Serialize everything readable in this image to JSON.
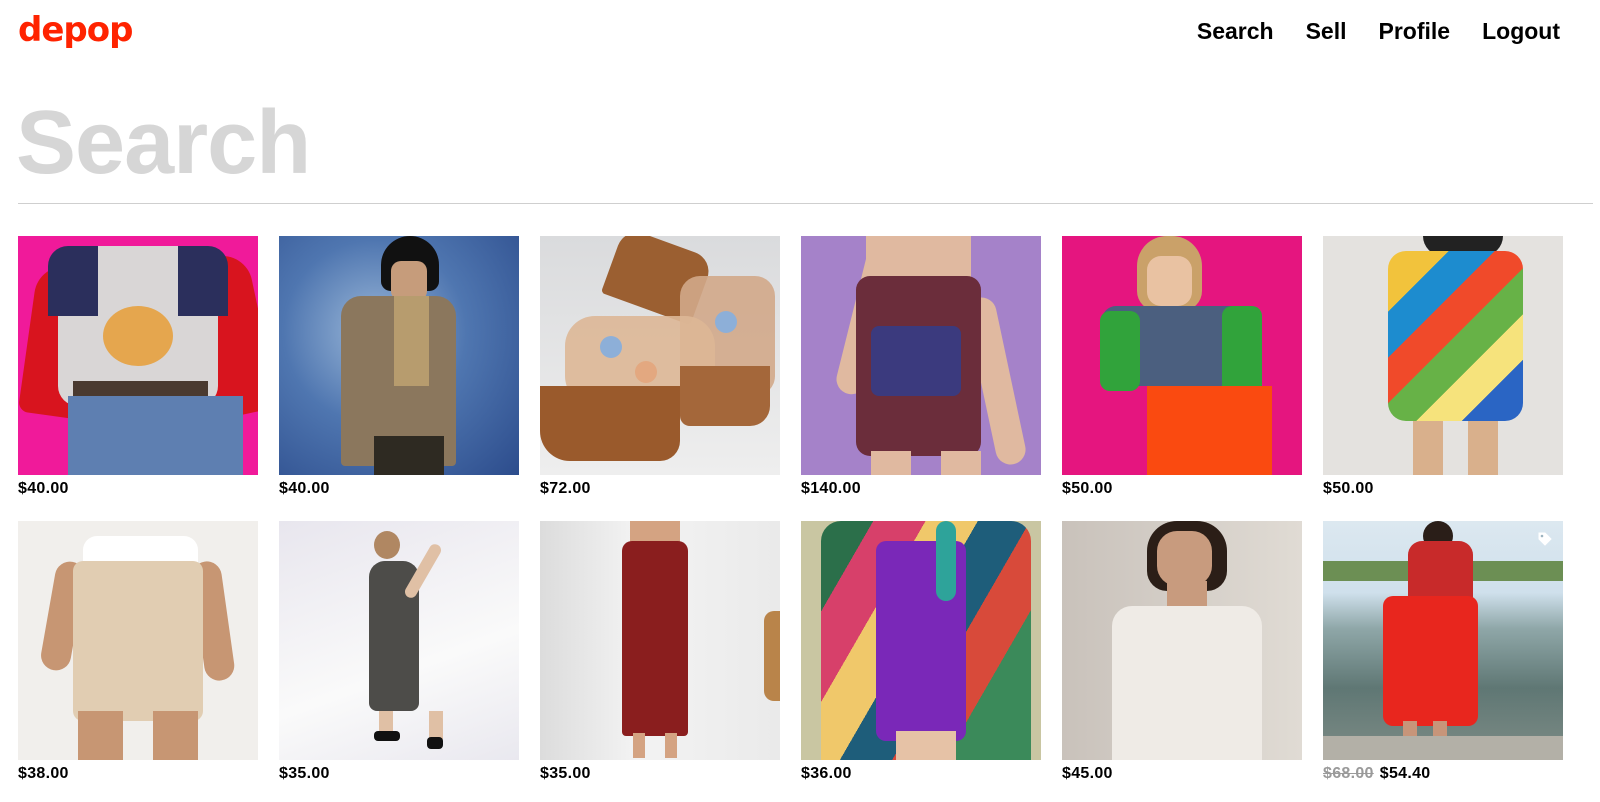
{
  "brand": {
    "logo_text": "depop",
    "color": "#ff2300"
  },
  "nav": {
    "items": [
      {
        "label": "Search"
      },
      {
        "label": "Sell"
      },
      {
        "label": "Profile"
      },
      {
        "label": "Logout"
      }
    ]
  },
  "page": {
    "title": "Search"
  },
  "products": [
    {
      "price": "$40.00",
      "original_price": ""
    },
    {
      "price": "$40.00",
      "original_price": ""
    },
    {
      "price": "$72.00",
      "original_price": ""
    },
    {
      "price": "$140.00",
      "original_price": ""
    },
    {
      "price": "$50.00",
      "original_price": ""
    },
    {
      "price": "$50.00",
      "original_price": ""
    },
    {
      "price": "$38.00",
      "original_price": ""
    },
    {
      "price": "$35.00",
      "original_price": ""
    },
    {
      "price": "$35.00",
      "original_price": ""
    },
    {
      "price": "$36.00",
      "original_price": ""
    },
    {
      "price": "$45.00",
      "original_price": ""
    },
    {
      "price": "$54.40",
      "original_price": "$68.00",
      "icon": "tag-icon"
    }
  ]
}
